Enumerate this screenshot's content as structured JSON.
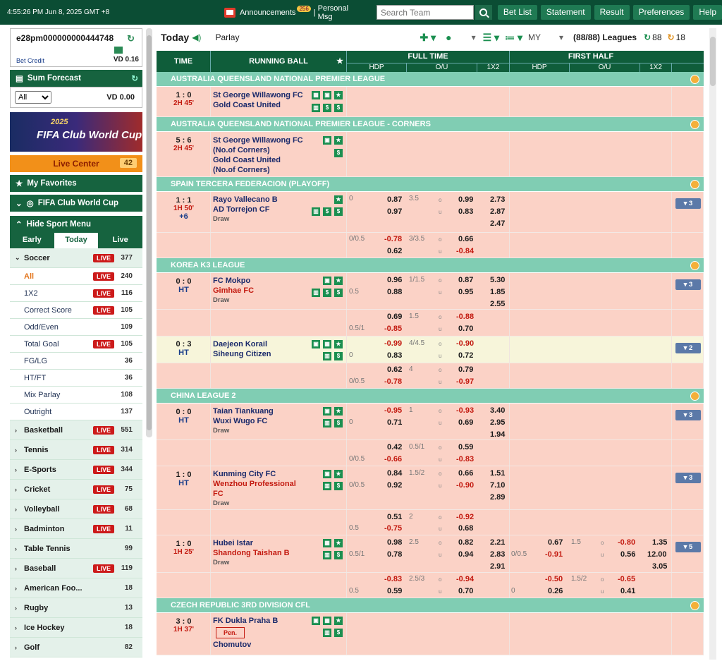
{
  "topbar": {
    "time": "4:55:26 PM Jun 8, 2025 GMT +8",
    "announcements": "Announcements",
    "ann_count": "256",
    "personal_msg": "Personal Msg",
    "search_placeholder": "Search Team",
    "buttons": [
      "Bet List",
      "Statement",
      "Result",
      "Preferences",
      "Help"
    ]
  },
  "user": {
    "id": "e28pm000000000444748",
    "bet_credit_label": "Bet Credit",
    "bet_credit_value": "VD  0.16"
  },
  "sum_forecast": {
    "title": "Sum Forecast",
    "select": "All",
    "value": "VD 0.00"
  },
  "banner": {
    "year": "2025",
    "title": "FIFA Club World Cup"
  },
  "live_center": {
    "label": "Live Center",
    "count": "42"
  },
  "my_favorites": "My Favorites",
  "club_world_cup": "FIFA Club World Cup",
  "hide_sport_menu": "Hide Sport Menu",
  "tabs": [
    "Early",
    "Today",
    "Live"
  ],
  "live_badge": "LIVE",
  "sports_top": {
    "name": "Soccer",
    "count": "377"
  },
  "soccer_sub": [
    {
      "name": "All",
      "live": true,
      "count": "240"
    },
    {
      "name": "1X2",
      "live": true,
      "count": "116"
    },
    {
      "name": "Correct Score",
      "live": true,
      "count": "105"
    },
    {
      "name": "Odd/Even",
      "live": false,
      "count": "109"
    },
    {
      "name": "Total Goal",
      "live": true,
      "count": "105"
    },
    {
      "name": "FG/LG",
      "live": false,
      "count": "36"
    },
    {
      "name": "HT/FT",
      "live": false,
      "count": "36"
    },
    {
      "name": "Mix Parlay",
      "live": false,
      "count": "108"
    },
    {
      "name": "Outright",
      "live": false,
      "count": "137"
    }
  ],
  "sports": [
    {
      "name": "Basketball",
      "live": true,
      "count": "551"
    },
    {
      "name": "Tennis",
      "live": true,
      "count": "314"
    },
    {
      "name": "E-Sports",
      "live": true,
      "count": "344"
    },
    {
      "name": "Cricket",
      "live": true,
      "count": "75"
    },
    {
      "name": "Volleyball",
      "live": true,
      "count": "68"
    },
    {
      "name": "Badminton",
      "live": true,
      "count": "11"
    },
    {
      "name": "Table Tennis",
      "live": false,
      "count": "99"
    },
    {
      "name": "Baseball",
      "live": true,
      "count": "119"
    },
    {
      "name": "American Foo...",
      "live": false,
      "count": "18"
    },
    {
      "name": "Rugby",
      "live": false,
      "count": "13"
    },
    {
      "name": "Ice Hockey",
      "live": false,
      "count": "18"
    },
    {
      "name": "Golf",
      "live": false,
      "count": "82"
    }
  ],
  "main_top": {
    "today": "Today",
    "parlay": "Parlay",
    "odds": "MY",
    "leagues": "(88/88) Leagues",
    "c1": "88",
    "c2": "18"
  },
  "header": {
    "time": "TIME",
    "running": "RUNNING BALL",
    "full_time": "FULL TIME",
    "first_half": "FIRST HALF",
    "hdp": "HDP",
    "ou": "O/U",
    "x12": "1X2"
  },
  "leagues": [
    "AUSTRALIA QUEENSLAND NATIONAL PREMIER LEAGUE",
    "AUSTRALIA QUEENSLAND NATIONAL PREMIER LEAGUE - CORNERS",
    "SPAIN TERCERA FEDERACION (PLAYOFF)",
    "KOREA K3 LEAGUE",
    "CHINA LEAGUE 2",
    "CZECH REPUBLIC 3RD DIVISION CFL"
  ],
  "matches": {
    "m1": {
      "score": "1 : 0",
      "time": "2H 45'",
      "home": "St George Willawong FC",
      "away": "Gold Coast United"
    },
    "m2": {
      "score": "5 : 6",
      "time": "2H 45'",
      "home": "St George Willawong FC",
      "home2": "(No.of Corners)",
      "away": "Gold Coast United",
      "away2": "(No.of Corners)"
    },
    "m3": {
      "score": "1 : 1",
      "time": "1H 50'",
      "extra": "+6",
      "home": "Rayo Vallecano B",
      "away": "AD Torrejon CF",
      "draw": "Draw"
    },
    "m4": {
      "score": "0 : 0",
      "time": "HT",
      "home": "FC Mokpo",
      "away": "Gimhae FC",
      "draw": "Draw"
    },
    "m5": {
      "score": "0 : 3",
      "time": "HT",
      "home": "Daejeon Korail",
      "away": "Siheung Citizen"
    },
    "m6": {
      "score": "0 : 0",
      "time": "HT",
      "home": "Taian Tiankuang",
      "away": "Wuxi Wugo FC",
      "draw": "Draw"
    },
    "m7": {
      "score": "1 : 0",
      "time": "HT",
      "home": "Kunming City FC",
      "away": "Wenzhou Professional",
      "away2": "FC",
      "draw": "Draw"
    },
    "m8": {
      "score": "1 : 0",
      "time": "1H 25'",
      "home": "Hubei Istar",
      "away": "Shandong Taishan B",
      "draw": "Draw"
    },
    "m9": {
      "score": "3 : 0",
      "time": "1H 37'",
      "home": "FK Dukla Praha B",
      "pen": "Pen.",
      "away": "Chomutov"
    }
  }
}
